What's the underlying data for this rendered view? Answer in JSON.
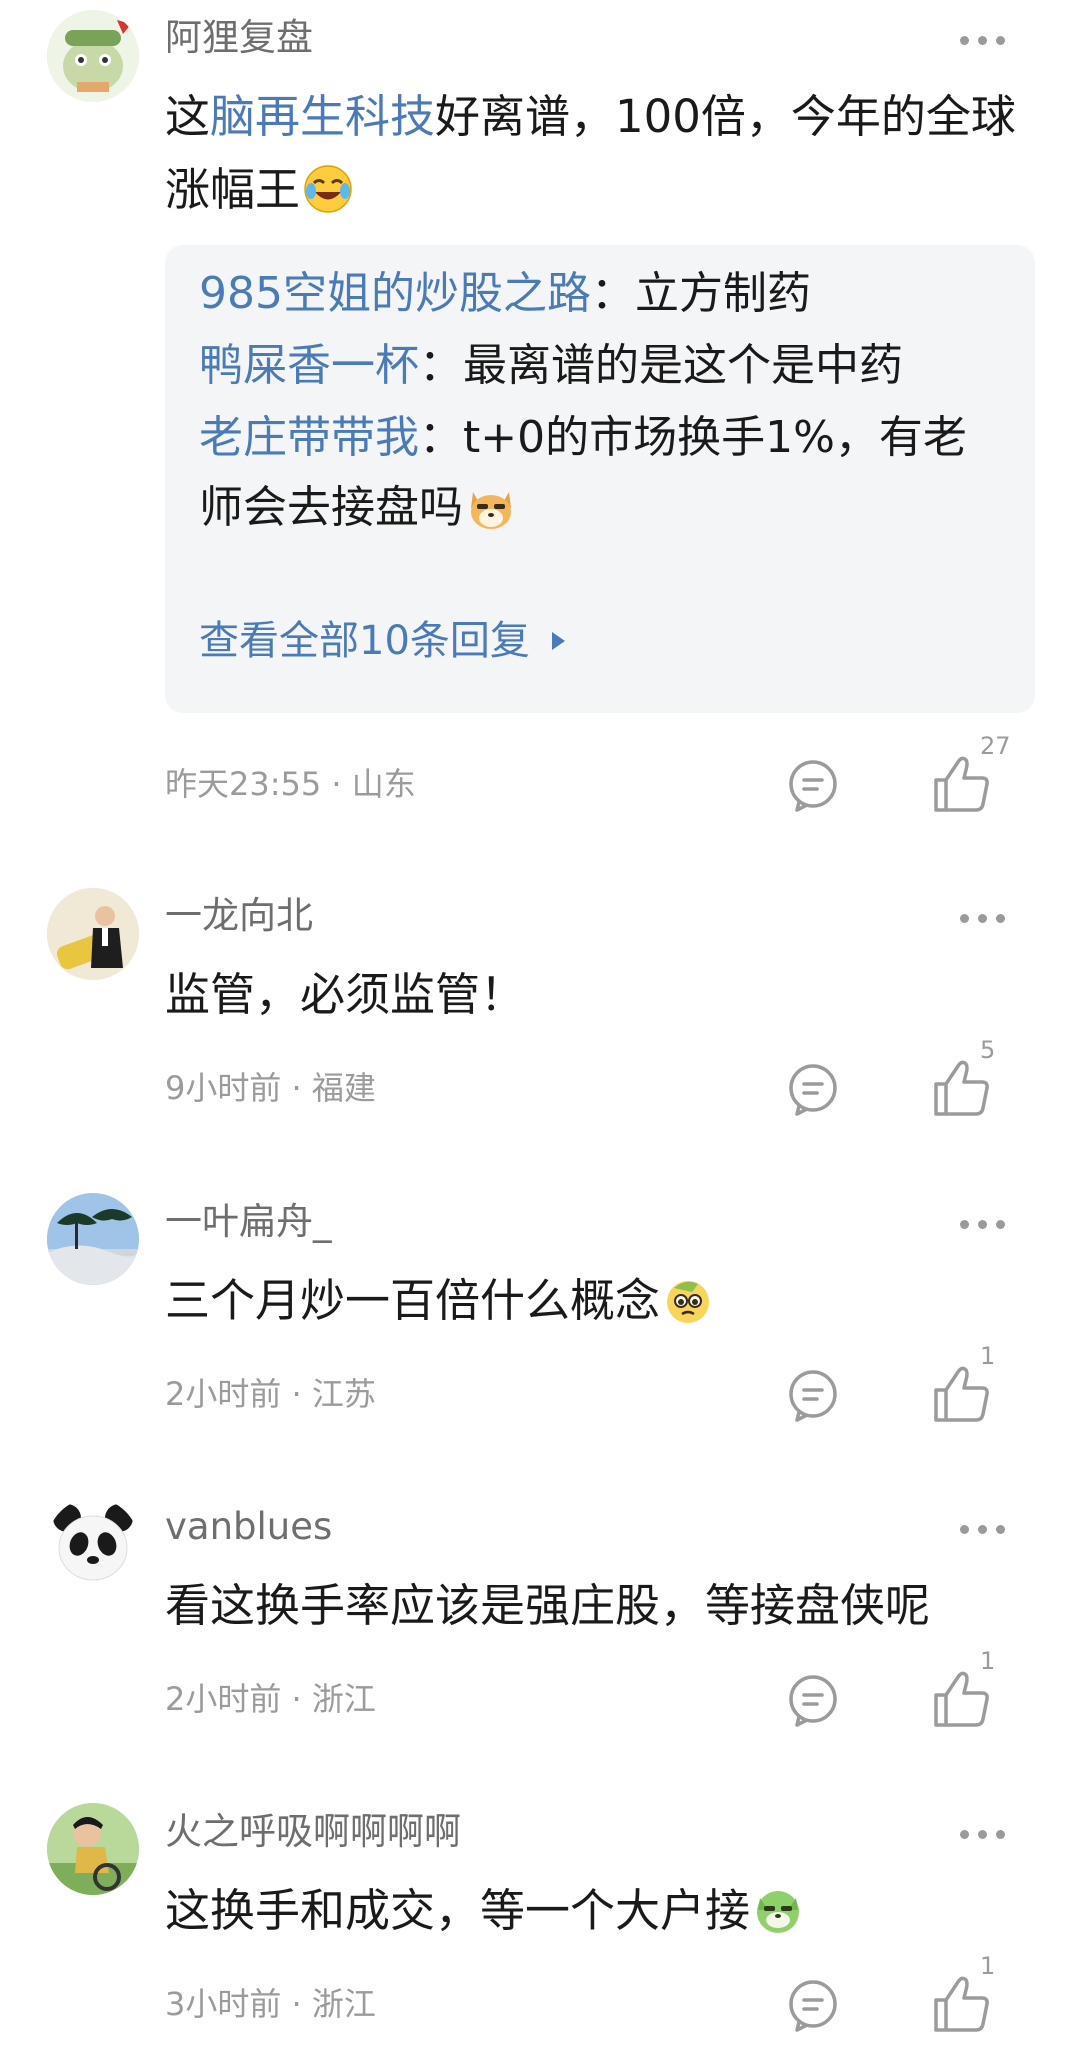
{
  "comments": [
    {
      "username": "阿狸复盘",
      "text_prefix": "这",
      "text_link": "脑再生科技",
      "text_rest": "好离谱，100倍，今年的全球涨幅王",
      "emoji": "laugh-cry-emoji",
      "replies": [
        {
          "user": "985空姐的炒股之路",
          "sep": "：",
          "text": "立方制药"
        },
        {
          "user": "鸭屎香一杯",
          "sep": "：",
          "text": "最离谱的是这个是中药"
        },
        {
          "user": "老庄带带我",
          "sep": "：",
          "text": "t+0的市场换手1%，有老师会去接盘吗",
          "emoji": "doge-emoji"
        }
      ],
      "view_all": "查看全部10条回复",
      "time": "昨天23:55",
      "location": "山东",
      "likes": "27"
    },
    {
      "username": "一龙向北",
      "text": "监管，必须监管！",
      "time": "9小时前",
      "location": "福建",
      "likes": "5"
    },
    {
      "username": "一叶扁舟_",
      "text": "三个月炒一百倍什么概念",
      "emoji": "pleading-emoji",
      "time": "2小时前",
      "location": "江苏",
      "likes": "1"
    },
    {
      "username": "vanblues",
      "text": "看这换手率应该是强庄股，等接盘侠呢",
      "time": "2小时前",
      "location": "浙江",
      "likes": "1"
    },
    {
      "username": "火之呼吸啊啊啊啊",
      "text": "这换手和成交，等一个大户接",
      "emoji": "green-doge-emoji",
      "time": "3小时前",
      "location": "浙江",
      "likes": "1"
    }
  ],
  "separator": " · ",
  "colors": {
    "link": "#4a7ab8",
    "meta": "#9b9b9b",
    "reply_bg": "#f4f5f7"
  }
}
